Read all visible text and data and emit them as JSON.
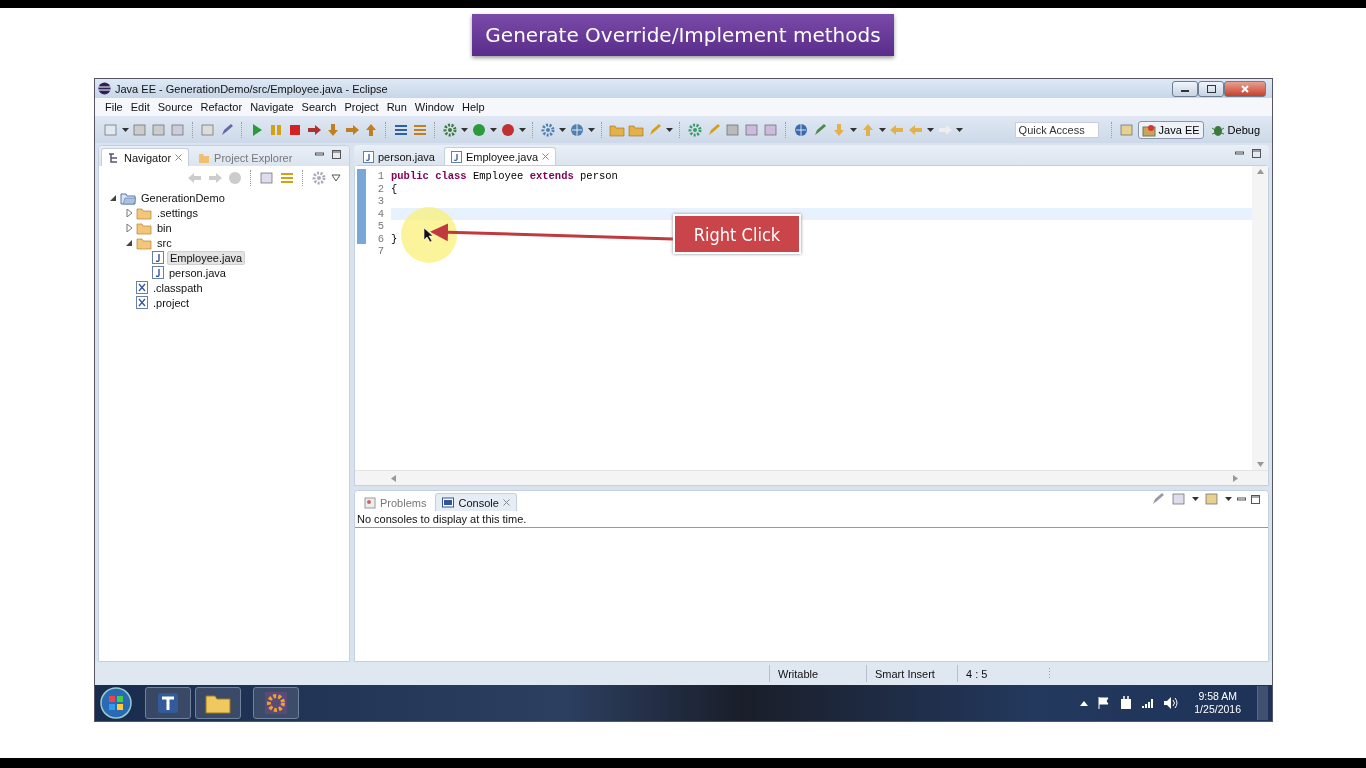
{
  "slide_title": "Generate Override/Implement methods",
  "window": {
    "title": "Java EE - GenerationDemo/src/Employee.java - Eclipse"
  },
  "menu": [
    "File",
    "Edit",
    "Source",
    "Refactor",
    "Navigate",
    "Search",
    "Project",
    "Run",
    "Window",
    "Help"
  ],
  "quick_access": {
    "placeholder": "Quick Access"
  },
  "perspectives": [
    {
      "label": "Java EE",
      "selected": true
    },
    {
      "label": "Debug",
      "selected": false
    }
  ],
  "left_tabs": [
    {
      "label": "Navigator",
      "selected": true
    },
    {
      "label": "Project Explorer",
      "selected": false
    }
  ],
  "tree": [
    {
      "label": "GenerationDemo",
      "kind": "project",
      "expanded": true,
      "selected": false,
      "children": [
        {
          "label": ".settings",
          "kind": "folder",
          "expanded": false,
          "selected": false
        },
        {
          "label": "bin",
          "kind": "folder",
          "expanded": false,
          "selected": false
        },
        {
          "label": "src",
          "kind": "folder",
          "expanded": true,
          "selected": false,
          "children": [
            {
              "label": "Employee.java",
              "kind": "java",
              "selected": true
            },
            {
              "label": "person.java",
              "kind": "java",
              "selected": false
            }
          ]
        },
        {
          "label": ".classpath",
          "kind": "xml",
          "selected": false
        },
        {
          "label": ".project",
          "kind": "xml",
          "selected": false
        }
      ]
    }
  ],
  "editor_tabs": [
    {
      "label": "person.java",
      "selected": false
    },
    {
      "label": "Employee.java",
      "selected": true
    }
  ],
  "code_lines": [
    {
      "number": "1",
      "text": "**public** **class** Employee **extends** person",
      "current": false
    },
    {
      "number": "2",
      "text": "{",
      "current": false
    },
    {
      "number": "3",
      "current": false
    },
    {
      "number": "4",
      "current": true
    },
    {
      "number": "5",
      "current": false
    },
    {
      "number": "6",
      "text": "}",
      "current": false
    },
    {
      "number": "7",
      "current": false
    }
  ],
  "annotation": "Right Click",
  "bottom_tabs": [
    {
      "label": "Problems",
      "selected": false
    },
    {
      "label": "Console",
      "selected": true
    }
  ],
  "console_message": "No consoles to display at this time.",
  "status_bar": [
    "Writable",
    "Smart Insert",
    "4 : 5"
  ],
  "taskbar": {
    "time": "9:58 AM",
    "date": "1/25/2016"
  }
}
